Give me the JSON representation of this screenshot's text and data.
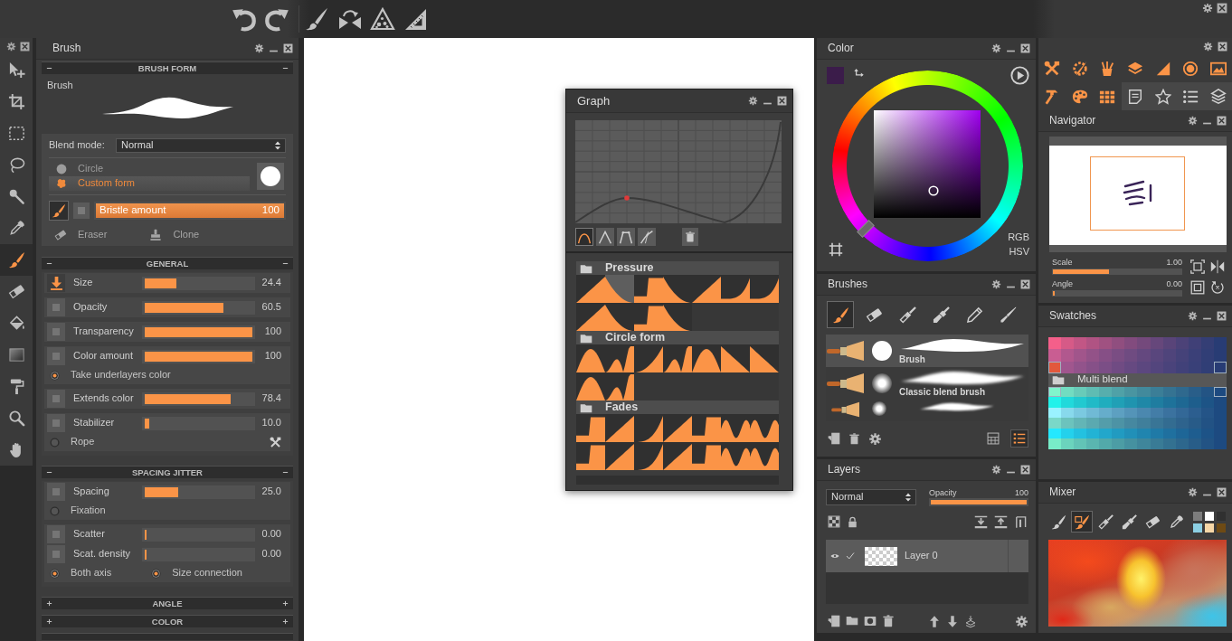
{
  "tool_column": {
    "tools": [
      {
        "selected": false
      },
      {
        "selected": false
      },
      {
        "selected": false
      },
      {
        "selected": false
      },
      {
        "selected": false
      },
      {
        "selected": false
      },
      {
        "selected": true
      },
      {
        "selected": false
      },
      {
        "selected": false
      },
      {
        "selected": false
      },
      {
        "selected": false
      },
      {
        "selected": false
      },
      {
        "selected": false
      }
    ]
  },
  "brush_panel": {
    "title": "Brush",
    "sections": [
      {
        "kind": "form",
        "heading": "BRUSH FORM",
        "expanded": true,
        "form_label": "Brush",
        "blend_label": "Blend mode:",
        "blend_value": "Normal",
        "forms": [
          {
            "kind": "circle",
            "label": "Circle",
            "selected": false
          },
          {
            "kind": "custom",
            "label": "Custom form",
            "selected": true
          }
        ],
        "bristle": {
          "label": "Bristle amount",
          "value": "100",
          "level": 1,
          "on": true
        },
        "actions": [
          {
            "label": "Eraser"
          },
          {
            "label": "Clone"
          }
        ]
      },
      {
        "kind": "controls",
        "heading": "GENERAL",
        "expanded": true,
        "groups": [
          {
            "rows": [
              {
                "kind": "slider",
                "label": "Size",
                "value": "24.4",
                "level": 0.3,
                "pressure": true
              }
            ]
          },
          {
            "rows": [
              {
                "kind": "slider",
                "label": "Opacity",
                "value": "60.5",
                "level": 0.73,
                "pressure": false
              }
            ]
          },
          {
            "rows": [
              {
                "kind": "slider",
                "label": "Transparency",
                "value": "100",
                "level": 1,
                "pressure": false
              }
            ]
          },
          {
            "rows": [
              {
                "kind": "slider",
                "label": "Color amount",
                "value": "100",
                "level": 1,
                "pressure": false
              },
              {
                "kind": "radios",
                "options": [
                  {
                    "label": "Take underlayers color",
                    "checked": true
                  }
                ]
              }
            ]
          },
          {
            "rows": [
              {
                "kind": "slider",
                "label": "Extends color",
                "value": "78.4",
                "level": 0.8,
                "pressure": false
              }
            ]
          },
          {
            "rows": [
              {
                "kind": "slider",
                "label": "Stabilizer",
                "value": "10.0",
                "level": 0.04,
                "pressure": false
              },
              {
                "kind": "radios",
                "options": [
                  {
                    "label": "Rope",
                    "checked": false
                  }
                ],
                "settings": true
              }
            ]
          }
        ]
      },
      {
        "kind": "controls",
        "heading": "SPACING JITTER",
        "expanded": true,
        "groups": [
          {
            "rows": [
              {
                "kind": "slider",
                "label": "Spacing",
                "value": "25.0",
                "level": 0.31,
                "pressure": false
              },
              {
                "kind": "radios",
                "options": [
                  {
                    "label": "Fixation",
                    "checked": false
                  }
                ]
              }
            ]
          },
          {
            "rows": [
              {
                "kind": "slider",
                "label": "Scatter",
                "value": "0.00",
                "level": 0,
                "pressure": false
              },
              {
                "kind": "slider",
                "label": "Scat. density",
                "value": "0.00",
                "level": 0,
                "pressure": false
              },
              {
                "kind": "radios",
                "options": [
                  {
                    "label": "Both axis",
                    "checked": true
                  },
                  {
                    "label": "Size connection",
                    "checked": true
                  }
                ]
              }
            ]
          }
        ]
      },
      {
        "heading": "ANGLE",
        "expanded": false
      },
      {
        "heading": "COLOR",
        "expanded": false
      }
    ]
  },
  "graph_panel": {
    "title": "Graph",
    "curve_modes": [
      {
        "selected": true
      },
      {
        "selected": false
      },
      {
        "selected": false
      },
      {
        "selected": false
      }
    ],
    "preset_groups": [
      {
        "name": "Pressure",
        "presets": [
          {
            "selected": false
          },
          {
            "selected": true
          },
          {
            "selected": false
          },
          {
            "selected": false
          },
          {
            "selected": false
          },
          {
            "selected": false
          },
          {
            "selected": false
          },
          {
            "selected": false
          },
          {
            "selected": false
          },
          {
            "selected": false
          },
          {
            "selected": false
          }
        ]
      },
      {
        "name": "Circle form",
        "presets": [
          {
            "selected": false
          },
          {
            "selected": false
          },
          {
            "selected": false
          },
          {
            "selected": false
          },
          {
            "selected": false
          },
          {
            "selected": false
          },
          {
            "selected": false
          },
          {
            "selected": false
          },
          {
            "selected": false
          }
        ]
      },
      {
        "name": "Fades",
        "presets": [
          {
            "selected": false
          },
          {
            "selected": false
          },
          {
            "selected": false
          },
          {
            "selected": false
          },
          {
            "selected": false
          },
          {
            "selected": false
          },
          {
            "selected": false
          },
          {
            "selected": false
          },
          {
            "selected": false
          },
          {
            "selected": false
          },
          {
            "selected": false
          },
          {
            "selected": false
          },
          {
            "selected": false
          },
          {
            "selected": false
          }
        ]
      }
    ]
  },
  "color_panel": {
    "title": "Color",
    "modes": [
      "RGB",
      "HSV"
    ]
  },
  "brushes_panel": {
    "title": "Brushes",
    "categories": [
      {
        "selected": true
      },
      {
        "selected": false
      },
      {
        "selected": false
      },
      {
        "selected": false
      },
      {
        "selected": false
      },
      {
        "selected": false
      }
    ],
    "brushes": [
      {
        "kind": "hard",
        "name": "Brush",
        "selected": true
      },
      {
        "kind": "soft",
        "name": "Classic blend brush",
        "selected": false
      },
      {
        "kind": "soft",
        "selected": false
      }
    ],
    "views": [
      {
        "selected": false
      },
      {
        "selected": true
      }
    ]
  },
  "layers_panel": {
    "title": "Layers",
    "blend_value": "Normal",
    "opacity": {
      "label": "Opacity",
      "value": "100",
      "level": 1
    },
    "layers": [
      {
        "name": "Layer 0",
        "visible": true,
        "checked": true,
        "selected": true
      }
    ]
  },
  "panel_bar": {
    "buttons": [
      {
        "on": true
      },
      {
        "on": true
      },
      {
        "on": true
      },
      {
        "on": true
      },
      {
        "on": true
      },
      {
        "on": true
      },
      {
        "on": true
      },
      {
        "on": true
      },
      {
        "on": true
      },
      {
        "on": true
      },
      {
        "on": false
      },
      {
        "on": false
      },
      {
        "on": false
      },
      {
        "on": false
      }
    ]
  },
  "navigator_panel": {
    "title": "Navigator",
    "scale": {
      "label": "Scale",
      "value": "1.00",
      "level": 0.44
    },
    "angle": {
      "label": "Angle",
      "value": "0.00",
      "level": 0
    }
  },
  "swatches_panel": {
    "title": "Swatches",
    "palettes": [
      {
        "kind": "rose"
      },
      {
        "kind": "aqua",
        "name": "Multi blend"
      }
    ]
  },
  "mixer_panel": {
    "title": "Mixer",
    "tools": [
      {
        "selected": false
      },
      {
        "selected": true
      },
      {
        "selected": false
      },
      {
        "selected": false
      },
      {
        "selected": false
      },
      {
        "selected": false
      }
    ],
    "swatches": [
      {
        "color": "#7d7d7d"
      },
      {
        "color": "#ffffff"
      },
      {
        "color": "#303030"
      },
      {
        "color": "#8ccfe3"
      },
      {
        "color": "#f6d7a7"
      },
      {
        "color": "#6e4a14"
      }
    ]
  }
}
